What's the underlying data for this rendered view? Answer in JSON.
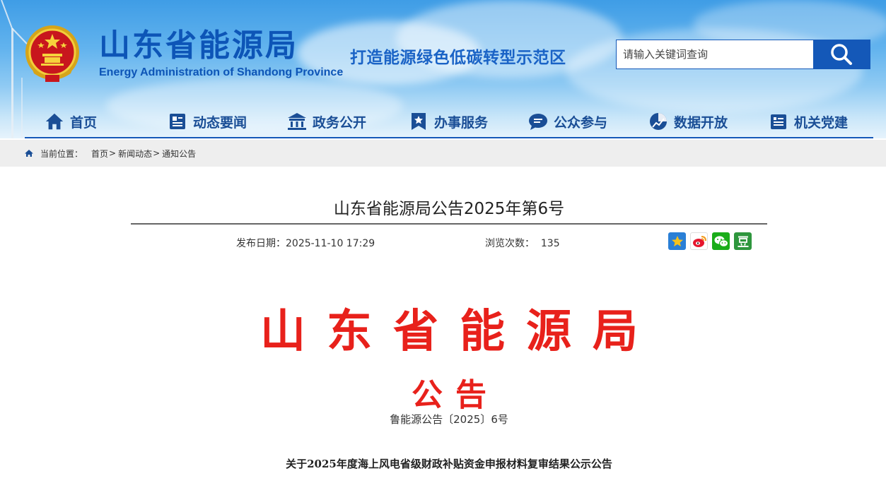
{
  "header": {
    "site_title": "山东省能源局",
    "site_subtitle": "Energy Administration of Shandong Province",
    "slogan": "打造能源绿色低碳转型示范区",
    "search": {
      "placeholder": "请输入关键词查询",
      "button_icon": "search-icon"
    }
  },
  "nav": {
    "items": [
      {
        "label": "首页",
        "icon": "home-icon"
      },
      {
        "label": "动态要闻",
        "icon": "news-icon"
      },
      {
        "label": "政务公开",
        "icon": "government-icon"
      },
      {
        "label": "办事服务",
        "icon": "service-icon"
      },
      {
        "label": "公众参与",
        "icon": "chat-icon"
      },
      {
        "label": "数据开放",
        "icon": "data-chart-icon"
      },
      {
        "label": "机关党建",
        "icon": "party-building-icon"
      }
    ]
  },
  "breadcrumb": {
    "prefix": "当前位置：",
    "items": [
      "首页",
      "新闻动态",
      "通知公告"
    ],
    "separator": ">"
  },
  "article": {
    "title": "山东省能源局公告2025年第6号",
    "date_label": "发布日期：2025-11-10 17:29",
    "views_label": "浏览次数：  135",
    "share_icons": [
      "qzone-icon",
      "weibo-icon",
      "wechat-icon",
      "douban-icon"
    ],
    "red_header": "山东省能源局",
    "notice_label": "公告",
    "doc_number": "鲁能源公告〔2025〕6号",
    "doc_heading": "关于2025年度海上风电省级财政补贴资金申报材料复审结果公示公告"
  },
  "colors": {
    "brand_blue": "#1458b8",
    "title_blue": "#0d55b7",
    "nav_text": "#1a4e96",
    "red_header": "#e8211b",
    "crumb_bg": "#eeeeee"
  }
}
